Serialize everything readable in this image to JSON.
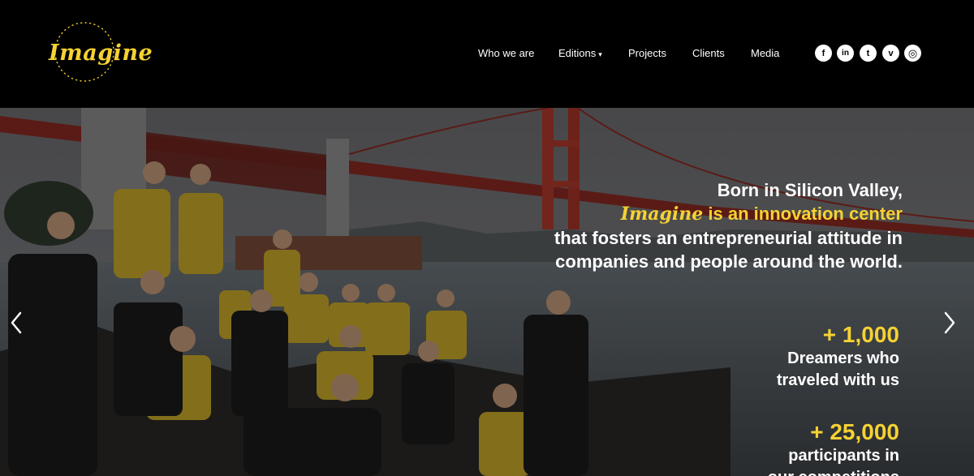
{
  "brand": {
    "logo_text": "Imagine",
    "accent_color": "#f5d233"
  },
  "nav": {
    "items": [
      {
        "label": "Who we are"
      },
      {
        "label": "Editions",
        "has_dropdown": true
      },
      {
        "label": "Projects"
      },
      {
        "label": "Clients"
      },
      {
        "label": "Media"
      }
    ],
    "dropdown_caret": "▾"
  },
  "social": [
    {
      "name": "facebook-icon",
      "glyph": "f"
    },
    {
      "name": "linkedin-icon",
      "glyph": "in"
    },
    {
      "name": "twitter-icon",
      "glyph": "t"
    },
    {
      "name": "vimeo-icon",
      "glyph": "v"
    },
    {
      "name": "instagram-icon",
      "glyph": "◎"
    }
  ],
  "hero": {
    "line1": "Born in Silicon Valley,",
    "line2_brand": "Imagine",
    "line2_rest": " is an innovation center",
    "line3": "that fosters an entrepreneurial attitude in",
    "line4": "companies and people around the world.",
    "stats": [
      {
        "number": "+ 1,000",
        "label_lines": [
          "Dreamers who",
          "traveled with us"
        ]
      },
      {
        "number": "+ 25,000",
        "label_lines": [
          "participants in",
          "our competitions"
        ]
      }
    ],
    "prev_arrow": "‹",
    "next_arrow": "›"
  }
}
